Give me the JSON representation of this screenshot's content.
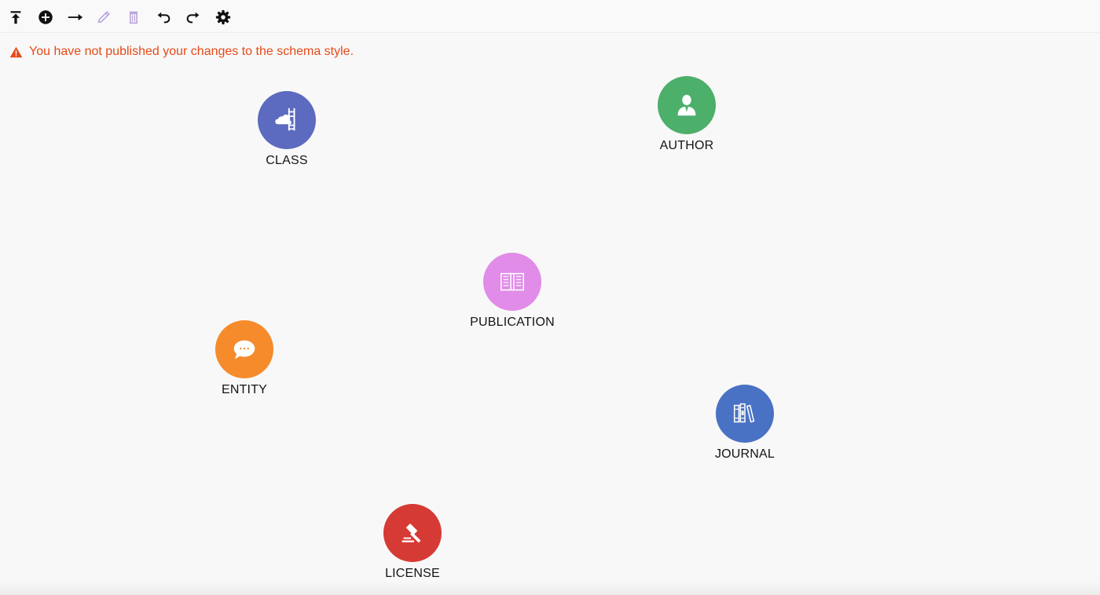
{
  "toolbar": {
    "buttons": [
      {
        "name": "upload-icon",
        "tooltip": ""
      },
      {
        "name": "add-circle-icon",
        "tooltip": ""
      },
      {
        "name": "arrow-right-icon",
        "tooltip": ""
      },
      {
        "name": "pencil-icon",
        "tooltip": ""
      },
      {
        "name": "trash-icon",
        "tooltip": ""
      },
      {
        "name": "undo-icon",
        "tooltip": ""
      },
      {
        "name": "redo-icon",
        "tooltip": ""
      },
      {
        "name": "gear-icon",
        "tooltip": ""
      }
    ],
    "colors": {
      "active": "#111111",
      "disabled": "#b39ddb"
    }
  },
  "warning": {
    "icon": "warning-triangle-icon",
    "text": "You have not published your changes to the schema style.",
    "color": "#e64a19"
  },
  "nodes": [
    {
      "id": "class",
      "label": "CLASS",
      "icon": "ladder-cloud-icon",
      "color": "#5c6bc0"
    },
    {
      "id": "author",
      "label": "AUTHOR",
      "icon": "person-icon",
      "color": "#4caf6a"
    },
    {
      "id": "publication",
      "label": "PUBLICATION",
      "icon": "open-book-icon",
      "color": "#e08ce8"
    },
    {
      "id": "entity",
      "label": "ENTITY",
      "icon": "speech-bubble-icon",
      "color": "#f68b2c"
    },
    {
      "id": "journal",
      "label": "JOURNAL",
      "icon": "books-icon",
      "color": "#4a72c4"
    },
    {
      "id": "license",
      "label": "LICENSE",
      "icon": "gavel-icon",
      "color": "#d63a34"
    }
  ]
}
